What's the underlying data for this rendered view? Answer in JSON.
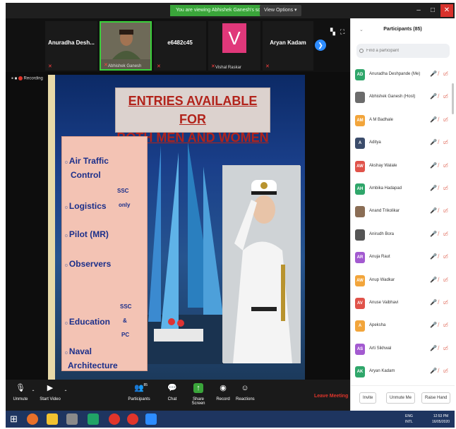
{
  "banner": {
    "viewing": "You are viewing Abhishek Ganesh's screen",
    "view_options": "View Options ▾"
  },
  "window": {
    "minimize": "–",
    "maximize": "□",
    "close": "✕"
  },
  "strip": {
    "tiles": [
      {
        "name": "Anuradha Desh..."
      },
      {
        "name": "",
        "label": "Abhishek Ganesh"
      },
      {
        "name": "e6482c45"
      },
      {
        "name": "",
        "label": "Vishal Raskar",
        "avatar": "V"
      },
      {
        "name": "Aryan Kadam"
      }
    ],
    "next_icon": "❯"
  },
  "recording": "Recording",
  "slide": {
    "title_line1": "ENTRIES AVAILABLE FOR",
    "title_line2": "BOTH MEN AND WOMEN",
    "entries": [
      "Air Traffic",
      "Control",
      "Logistics",
      "Pilot (MR)",
      "Observers",
      "Education",
      "Naval",
      "Architecture"
    ],
    "tag_ssc": "SSC",
    "tag_only": "only",
    "tag_ssc2": "SSC",
    "tag_amp": "&",
    "tag_pc": "PC"
  },
  "toolbar": {
    "unmute": "Unmute",
    "start_video": "Start Video",
    "participants": "Participants",
    "participants_count": "85",
    "chat": "Chat",
    "share_screen": "Share Screen",
    "record": "Record",
    "reactions": "Reactions",
    "leave": "Leave Meeting"
  },
  "panel": {
    "title": "Participants (85)",
    "search_placeholder": "Find a participant",
    "participants": [
      {
        "initials": "AD",
        "name": "Anuradha Deshpande (Me)",
        "color": "#2fa66a"
      },
      {
        "initials": "",
        "name": "Abhishek Ganesh (Host)",
        "color": "#6b6b6b"
      },
      {
        "initials": "AM",
        "name": "A M Badhale",
        "color": "#f2a53b"
      },
      {
        "initials": "A",
        "name": "Aditya",
        "color": "#3b4c6b"
      },
      {
        "initials": "AW",
        "name": "Akshay Walale",
        "color": "#e0534a"
      },
      {
        "initials": "AH",
        "name": "Ambika Hadapad",
        "color": "#2fa66a"
      },
      {
        "initials": "",
        "name": "Anand Trikolikar",
        "color": "#8a6d55"
      },
      {
        "initials": "",
        "name": "Anirudh Bora",
        "color": "#555555"
      },
      {
        "initials": "AR",
        "name": "Anuja Raut",
        "color": "#a35ad0"
      },
      {
        "initials": "AW",
        "name": "Anup Wadkar",
        "color": "#f2a53b"
      },
      {
        "initials": "AV",
        "name": "Anuse Vaibhavi",
        "color": "#e0534a"
      },
      {
        "initials": "A",
        "name": "Apeksha",
        "color": "#f2a53b"
      },
      {
        "initials": "AS",
        "name": "Arti Sikhwal",
        "color": "#a35ad0"
      },
      {
        "initials": "AK",
        "name": "Aryan Kadam",
        "color": "#2fa66a"
      }
    ],
    "invite": "Invite",
    "unmute_me": "Unmute Me",
    "raise_hand": "Raise Hand"
  },
  "taskbar": {
    "lang": "ENG",
    "locale": "INTL",
    "time": "12:53 PM",
    "date": "16/05/2020"
  }
}
